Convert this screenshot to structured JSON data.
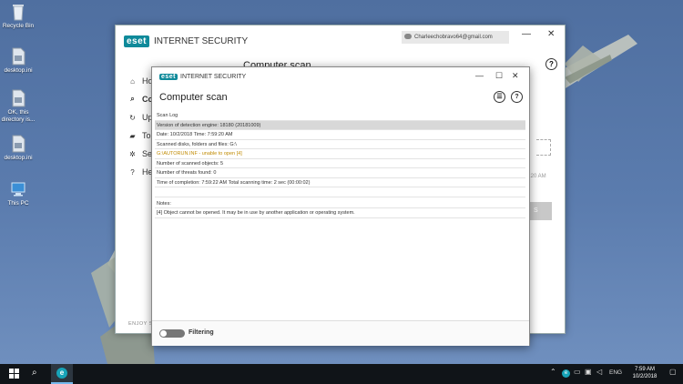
{
  "desktop": {
    "icons": [
      {
        "label": "Recycle Bin",
        "icon": "recycle-bin-icon"
      },
      {
        "label": "desktop.ini",
        "icon": "file-icon"
      },
      {
        "label": "OK, this directory is...",
        "icon": "file-icon"
      },
      {
        "label": "desktop.ini",
        "icon": "file-icon"
      },
      {
        "label": "This PC",
        "icon": "computer-icon"
      }
    ]
  },
  "main_window": {
    "logo": "eset",
    "product": "INTERNET SECURITY",
    "account": "Charleechobravo64@gmail.com",
    "minimize": "—",
    "close": "✕",
    "heading": "Computer scan",
    "help": "?",
    "sidebar": [
      {
        "label": "Ho",
        "icon": "home-icon"
      },
      {
        "label": "Co",
        "icon": "search-icon"
      },
      {
        "label": "Up",
        "icon": "update-icon"
      },
      {
        "label": "To",
        "icon": "toolbox-icon"
      },
      {
        "label": "Se",
        "icon": "gear-icon"
      },
      {
        "label": "He",
        "icon": "help-icon"
      }
    ],
    "bg_time": ":20 AM",
    "bg_button": "S",
    "footer": "ENJOY SA"
  },
  "dialog": {
    "logo": "eset",
    "product": "INTERNET SECURITY",
    "minimize": "—",
    "maximize": "☐",
    "close": "✕",
    "heading": "Computer scan",
    "list_icon": "☰",
    "help_icon": "?",
    "log": [
      "Scan Log",
      "Version of detection engine: 18180 (20181009)",
      "Date: 10/2/2018  Time: 7:59:20 AM",
      "Scanned disks, folders and files: G:\\",
      "G:\\AUTORUN.INF - unable to open [4]",
      "Number of scanned objects: 5",
      "Number of threats found: 0",
      "Time of completion: 7:59:22 AM  Total scanning time: 2 sec (00:00:02)",
      "",
      "Notes:",
      "[4] Object cannot be opened. It may be in use by another application or operating system."
    ],
    "filtering_label": "Filtering",
    "filtering_on": false
  },
  "taskbar": {
    "language": "ENG",
    "time": "7:59 AM",
    "date": "10/2/2018"
  },
  "colors": {
    "eset_teal": "#0f8a9a",
    "warning": "#c08a00",
    "taskbar": "#101418"
  }
}
